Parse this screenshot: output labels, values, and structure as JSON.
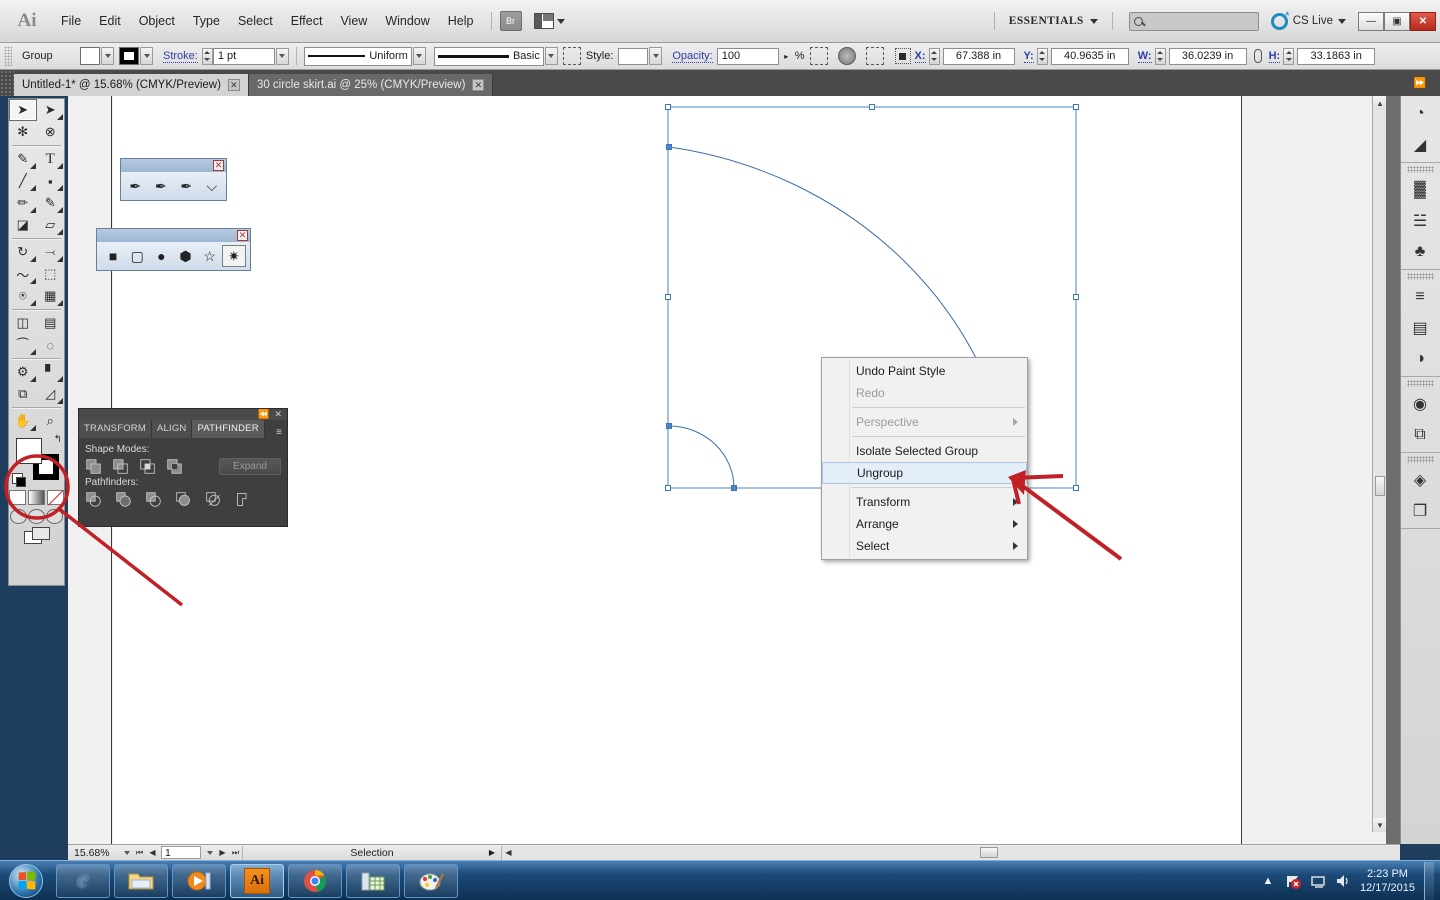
{
  "app": {
    "logo": "Ai",
    "menus": [
      "File",
      "Edit",
      "Object",
      "Type",
      "Select",
      "Effect",
      "View",
      "Window",
      "Help"
    ],
    "bridge_label": "Br",
    "workspace": "ESSENTIALS",
    "search_placeholder": "",
    "cs_live": "CS Live",
    "window_buttons": {
      "minimize": "—",
      "restore": "▣",
      "close": "✕"
    }
  },
  "control_bar": {
    "selection_label": "Group",
    "stroke_label": "Stroke:",
    "stroke_weight": "1 pt",
    "profile": "Uniform",
    "brush": "Basic",
    "style_label": "Style:",
    "opacity_label": "Opacity:",
    "opacity_value": "100",
    "percent": "%",
    "x_label": "X:",
    "x_value": "67.388 in",
    "y_label": "Y:",
    "y_value": "40.9635 in",
    "w_label": "W:",
    "w_value": "36.0239 in",
    "h_label": "H:",
    "h_value": "33.1863 in"
  },
  "tabs": [
    {
      "title": "Untitled-1* @ 15.68% (CMYK/Preview)",
      "close": "✕",
      "active": true
    },
    {
      "title": "30 circle skirt.ai @ 25% (CMYK/Preview)",
      "close": "✕",
      "active": false
    }
  ],
  "toolbar": {
    "tools": [
      {
        "name": "selection-tool",
        "glyph": "➤",
        "selected": true
      },
      {
        "name": "direct-selection-tool",
        "glyph": "➤",
        "selected": false
      },
      {
        "name": "magic-wand-tool",
        "glyph": "✳",
        "selected": false
      },
      {
        "name": "lasso-tool",
        "glyph": "⊂",
        "selected": false
      },
      {
        "name": "pen-tool",
        "glyph": "✒",
        "selected": false
      },
      {
        "name": "type-tool",
        "glyph": "T",
        "selected": false
      },
      {
        "name": "line-segment-tool",
        "glyph": "╲",
        "selected": false
      },
      {
        "name": "rectangle-tool",
        "glyph": "▣",
        "selected": false
      },
      {
        "name": "paintbrush-tool",
        "glyph": "✎",
        "selected": false
      },
      {
        "name": "pencil-tool",
        "glyph": "✏",
        "selected": false
      },
      {
        "name": "blob-brush-tool",
        "glyph": "◖",
        "selected": false
      },
      {
        "name": "eraser-tool",
        "glyph": "▱",
        "selected": false
      },
      {
        "name": "rotate-tool",
        "glyph": "↻",
        "selected": false
      },
      {
        "name": "scale-tool",
        "glyph": "⤡",
        "selected": false
      },
      {
        "name": "width-tool",
        "glyph": "〜",
        "selected": false
      },
      {
        "name": "free-transform-tool",
        "glyph": "⬚",
        "selected": false
      },
      {
        "name": "shape-builder-tool",
        "glyph": "⍟",
        "selected": false
      },
      {
        "name": "perspective-grid-tool",
        "glyph": "▦",
        "selected": false
      },
      {
        "name": "mesh-tool",
        "glyph": "⬛",
        "selected": false
      },
      {
        "name": "gradient-tool",
        "glyph": "▤",
        "selected": false
      },
      {
        "name": "eyedropper-tool",
        "glyph": "✒",
        "selected": false
      },
      {
        "name": "blend-tool",
        "glyph": "◌",
        "selected": false
      },
      {
        "name": "symbol-sprayer-tool",
        "glyph": "☃",
        "selected": false
      },
      {
        "name": "column-graph-tool",
        "glyph": "█",
        "selected": false
      },
      {
        "name": "artboard-tool",
        "glyph": "⧉",
        "selected": false
      },
      {
        "name": "slice-tool",
        "glyph": "✂",
        "selected": false
      },
      {
        "name": "hand-tool",
        "glyph": "✋",
        "selected": false
      },
      {
        "name": "zoom-tool",
        "glyph": "⚲",
        "selected": false
      }
    ],
    "swap_glyph": "↰"
  },
  "mini_panel_pen": {
    "tools": [
      {
        "name": "pen-tool",
        "glyph": "✒"
      },
      {
        "name": "add-anchor-point-tool",
        "glyph": "✒"
      },
      {
        "name": "delete-anchor-point-tool",
        "glyph": "✒"
      },
      {
        "name": "convert-anchor-point-tool",
        "glyph": "⌵"
      }
    ],
    "close": "✕"
  },
  "mini_panel_shapes": {
    "tools": [
      {
        "name": "rectangle-tool",
        "glyph": "■"
      },
      {
        "name": "rounded-rectangle-tool",
        "glyph": "▢"
      },
      {
        "name": "ellipse-tool",
        "glyph": "●"
      },
      {
        "name": "polygon-tool",
        "glyph": "⬢"
      },
      {
        "name": "star-tool",
        "glyph": "☆"
      },
      {
        "name": "flare-tool",
        "glyph": "✷"
      }
    ],
    "close": "✕"
  },
  "pathfinder_panel": {
    "collapse": "⏪",
    "close": "✕",
    "tabs": [
      {
        "label": "TRANSFORM",
        "active": false
      },
      {
        "label": "ALIGN",
        "active": false
      },
      {
        "label": "PATHFINDER",
        "active": true
      }
    ],
    "menu_glyph": "≡",
    "shape_modes_label": "Shape Modes:",
    "shape_modes": [
      "unite",
      "minus-front",
      "intersect",
      "exclude"
    ],
    "expand_label": "Expand",
    "pathfinders_label": "Pathfinders:",
    "pathfinders": [
      "divide",
      "trim",
      "merge",
      "crop",
      "outline",
      "minus-back"
    ]
  },
  "context_menu": {
    "items": [
      {
        "label": "Undo Paint Style",
        "disabled": false,
        "submenu": false,
        "highlighted": false
      },
      {
        "label": "Redo",
        "disabled": true,
        "submenu": false,
        "highlighted": false
      },
      {
        "separator": true
      },
      {
        "label": "Perspective",
        "disabled": true,
        "submenu": true,
        "highlighted": false
      },
      {
        "separator": true
      },
      {
        "label": "Isolate Selected Group",
        "disabled": false,
        "submenu": false,
        "highlighted": false
      },
      {
        "label": "Ungroup",
        "disabled": false,
        "submenu": false,
        "highlighted": true
      },
      {
        "separator": true
      },
      {
        "label": "Transform",
        "disabled": false,
        "submenu": true,
        "highlighted": false
      },
      {
        "label": "Arrange",
        "disabled": false,
        "submenu": true,
        "highlighted": false
      },
      {
        "label": "Select",
        "disabled": false,
        "submenu": true,
        "highlighted": false
      }
    ]
  },
  "status_bar": {
    "zoom": "15.68%",
    "page": "1",
    "status": "Selection",
    "first_glyph": "⏮",
    "prev_glyph": "◀",
    "next_glyph": "▶",
    "last_glyph": "⏭"
  },
  "dock": {
    "groups": [
      {
        "buttons": [
          {
            "name": "color-panel-icon",
            "glyph": "◔"
          },
          {
            "name": "gradient-panel-icon",
            "glyph": "◢"
          }
        ]
      },
      {
        "buttons": [
          {
            "name": "swatches-panel-icon",
            "glyph": "▓"
          },
          {
            "name": "brushes-panel-icon",
            "glyph": "☱"
          },
          {
            "name": "symbols-panel-icon",
            "glyph": "♣"
          }
        ]
      },
      {
        "buttons": [
          {
            "name": "stroke-panel-icon",
            "glyph": "≡"
          },
          {
            "name": "gradient2-panel-icon",
            "glyph": "▤"
          },
          {
            "name": "transparency-panel-icon",
            "glyph": "◑"
          }
        ]
      },
      {
        "buttons": [
          {
            "name": "appearance-panel-icon",
            "glyph": "◉"
          },
          {
            "name": "graphic-styles-panel-icon",
            "glyph": "⧉"
          }
        ]
      },
      {
        "buttons": [
          {
            "name": "layers-panel-icon",
            "glyph": "◈"
          },
          {
            "name": "artboards-panel-icon",
            "glyph": "❐"
          }
        ]
      }
    ],
    "toggle_glyph": "⏩"
  },
  "taskbar": {
    "items": [
      {
        "name": "internet-explorer",
        "glyph": "e",
        "active": false
      },
      {
        "name": "windows-explorer",
        "glyph": "Ὄ1",
        "active": false
      },
      {
        "name": "media-player",
        "glyph": "▶",
        "active": false
      },
      {
        "name": "adobe-illustrator",
        "glyph": "Ai",
        "active": true
      },
      {
        "name": "google-chrome",
        "glyph": "◯",
        "active": false
      },
      {
        "name": "spreadsheet-app",
        "glyph": "▦",
        "active": false
      },
      {
        "name": "paint-app",
        "glyph": "Ἲ8",
        "active": false
      }
    ],
    "tray": {
      "show_hidden": "▲",
      "icons": [
        "network-error-icon",
        "action-center-icon",
        "volume-icon"
      ],
      "time": "2:23 PM",
      "date": "12/17/2015"
    }
  },
  "annotations": {
    "circle_target": "fill-stroke-swatch",
    "arrow_target": "ungroup-menu-item",
    "color": "#c22027"
  },
  "artwork": {
    "description": "Two concentric quarter-circle arcs selected as a group",
    "selection_color": "#4a86c8"
  }
}
